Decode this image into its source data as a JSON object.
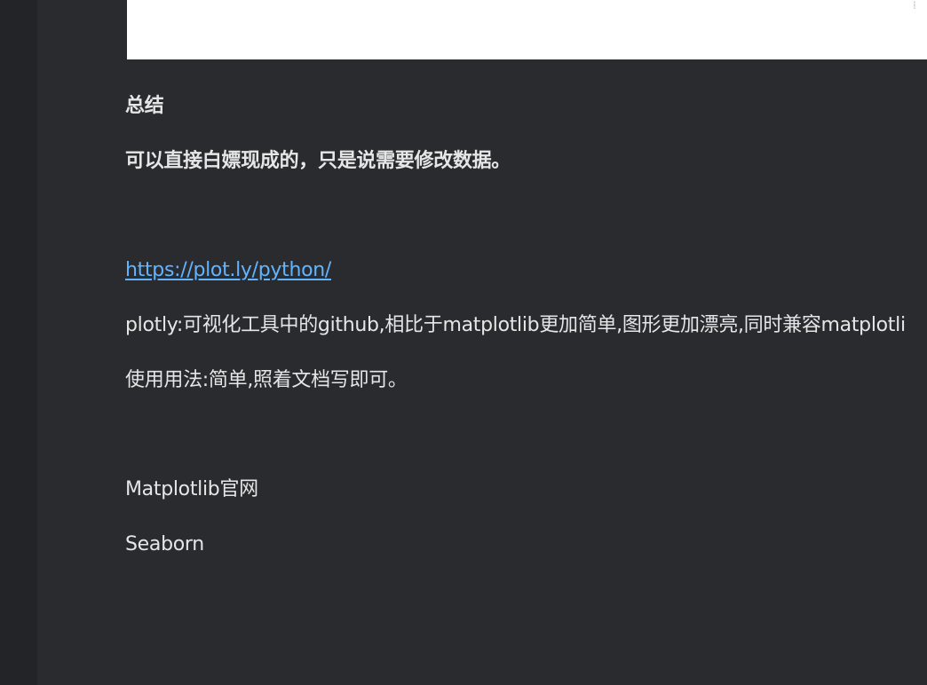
{
  "summary": {
    "heading": "总结",
    "note": "可以直接白嫖现成的，只是说需要修改数据。"
  },
  "plotly": {
    "link": "https://plot.ly/python/",
    "description": "plotly:可视化工具中的github,相比于matplotlib更加简单,图形更加漂亮,同时兼容matplotli",
    "usage": "使用用法:简单,照着文档写即可。"
  },
  "links": {
    "matplotlib": "Matplotlib官网",
    "seaborn": "Seaborn"
  }
}
